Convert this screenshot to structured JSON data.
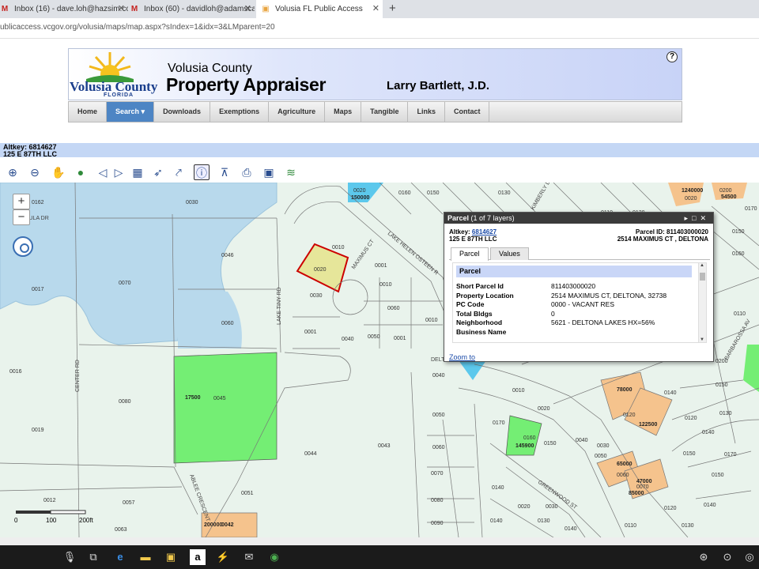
{
  "browser": {
    "tabs": [
      {
        "title": "Inbox (16) - dave.loh@hazsim.co",
        "icon": "gmail-icon"
      },
      {
        "title": "Inbox (60) - davidloh@adamscar",
        "icon": "gmail-icon"
      },
      {
        "title": "Volusia FL Public Access",
        "icon": "site-icon"
      }
    ],
    "url": "ublicaccess.vcgov.org/volusia/maps/map.aspx?sIndex=1&idx=3&LMparent=20"
  },
  "header": {
    "county_logo": "Volusia County",
    "county_state": "FLORIDA",
    "line1": "Volusia County",
    "line2": "Property Appraiser",
    "appraiser": "Larry Bartlett, J.D.",
    "help": "?"
  },
  "nav": [
    "Home",
    "Search ▾",
    "Downloads",
    "Exemptions",
    "Agriculture",
    "Maps",
    "Tangible",
    "Links",
    "Contact"
  ],
  "altkey_bar": {
    "altkey": "Altkey: 6814627",
    "owner": "125 E 87TH LLC"
  },
  "map": {
    "street_labels": [
      "MPULA DR",
      "MAXIMUS CT",
      "LAKE HELEN OSTEEN R",
      "LAKE TINY RD",
      "CENTER RD",
      "ABLEE CRESCENT",
      "GREENWOOD ST",
      "KIMBERLY DR",
      "BARBAROSSA AV",
      "DELT"
    ],
    "parcel_labels": [
      "0162",
      "0030",
      "0070",
      "0046",
      "0017",
      "0060",
      "0016",
      "0080",
      "0019",
      "0012",
      "0057",
      "0063",
      "0045",
      "0044",
      "0051",
      "0043",
      "0010",
      "0020",
      "0030",
      "0001",
      "0040",
      "0050",
      "0001",
      "0060",
      "0010",
      "0150",
      "0160",
      "0130",
      "0110",
      "0120",
      "0020",
      "0030",
      "0040",
      "0050",
      "0060",
      "0070",
      "0080",
      "0090",
      "0170",
      "0150",
      "0100",
      "0140",
      "0130",
      "0200",
      "0190",
      "0180",
      "0110",
      "0140",
      "0120",
      "0130",
      "0150",
      "0160",
      "0170",
      "0010",
      "0020",
      "0030",
      "0040",
      "0010",
      "0160",
      "0150",
      "0140",
      "0120",
      "0130",
      "0140",
      "0150",
      "0160",
      "0170",
      "0180",
      "0190",
      "0210",
      "0100",
      "0090",
      "0080"
    ],
    "value_labels": [
      "150000",
      "17500",
      "145900",
      "78000",
      "122500",
      "65000",
      "47000",
      "85000",
      "200000",
      "1240000",
      "54500"
    ],
    "scale": [
      "0",
      "100",
      "200ft"
    ],
    "zoom_in": "+",
    "zoom_out": "−"
  },
  "popup": {
    "title": "Parcel",
    "layers": "(1 of 7 layers)",
    "altkey_label": "Altkey:",
    "altkey_value": "6814627",
    "parcel_id": "Parcel ID: 811403000020",
    "owner": "125 E 87TH LLC",
    "address": "2514 MAXIMUS CT , DELTONA",
    "tabs": [
      "Parcel",
      "Values"
    ],
    "section": "Parcel",
    "rows": [
      {
        "k": "Short Parcel Id",
        "v": "811403000020"
      },
      {
        "k": "Property Location",
        "v": "2514 MAXIMUS CT, DELTONA, 32738"
      },
      {
        "k": "PC Code",
        "v": "0000 - VACANT RES"
      },
      {
        "k": "Total Bldgs",
        "v": "0"
      },
      {
        "k": "Neighborhood",
        "v": "5621 - DELTONA LAKES HX=56%"
      },
      {
        "k": "Business Name",
        "v": ""
      }
    ],
    "zoom_to": "Zoom to"
  },
  "colors": {
    "water": "#b8d9ec",
    "parcel_bg": "#e9f3ec",
    "selected_parcel": "#e6e69a",
    "green_parcel": "#74ee74",
    "orange_parcel": "#f5c38d",
    "accent": "#4d85c4"
  }
}
